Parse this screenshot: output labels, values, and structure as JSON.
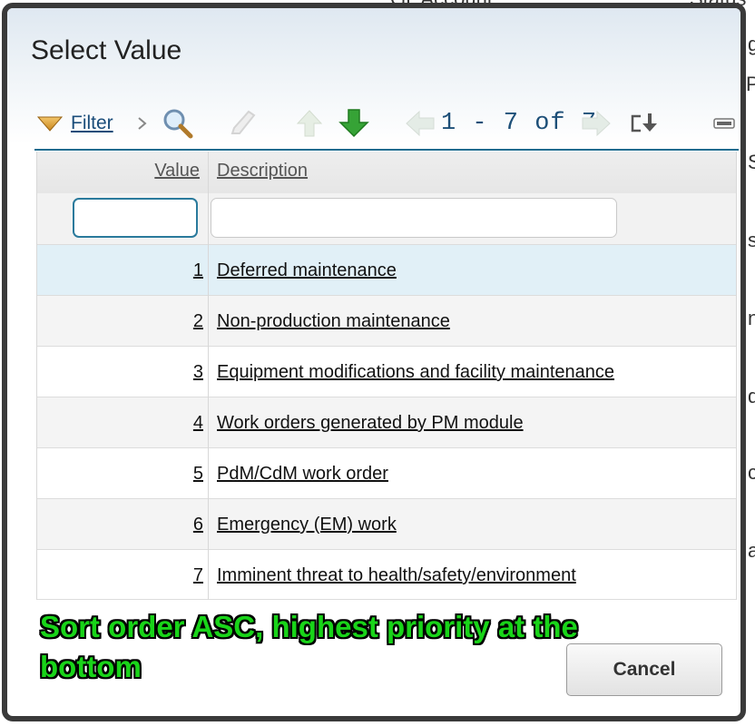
{
  "background": {
    "fragments": [
      "GL Account",
      "Status",
      "g",
      "P",
      "S",
      "s",
      "n",
      "d",
      "c",
      "a"
    ]
  },
  "dialog": {
    "title": "Select Value",
    "toolbar": {
      "filter_label": "Filter",
      "pager_text": "1 - 7 of 7",
      "icons": [
        "filter-funnel-icon",
        "chevron-right-icon",
        "search-magnifier-icon",
        "clear-eraser-icon",
        "sort-up-arrow-icon",
        "sort-down-arrow-icon",
        "prev-page-arrow-icon",
        "next-page-arrow-icon",
        "download-export-icon",
        "minimize-icon"
      ]
    },
    "table": {
      "columns": [
        "Value",
        "Description"
      ],
      "filter_values": {
        "value": "",
        "description": ""
      },
      "rows": [
        {
          "value": "1",
          "description": "Deferred maintenance"
        },
        {
          "value": "2",
          "description": "Non-production maintenance"
        },
        {
          "value": "3",
          "description": "Equipment modifications and facility maintenance"
        },
        {
          "value": "4",
          "description": "Work orders generated by PM module"
        },
        {
          "value": "5",
          "description": "PdM/CdM work order"
        },
        {
          "value": "6",
          "description": "Emergency (EM) work"
        },
        {
          "value": "7",
          "description": "Imminent threat to health/safety/environment"
        }
      ]
    },
    "annotation": "Sort order ASC, highest priority at the bottom",
    "cancel_label": "Cancel"
  },
  "colors": {
    "selected_row": "#e1f0f7",
    "alt_row": "#f4f4f4",
    "link": "#1a4d7a",
    "accent_line": "#1f6c8f",
    "annotation_text": "#19d419",
    "arrow_green": "#2e9b2e"
  }
}
